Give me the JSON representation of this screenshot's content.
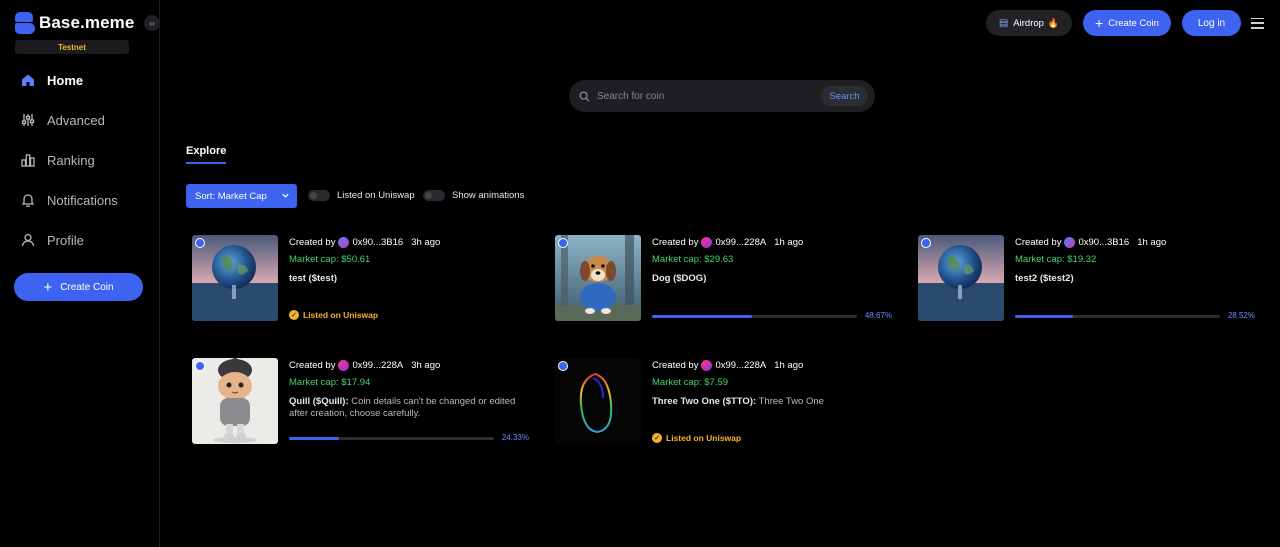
{
  "brand": {
    "name": "Base.meme",
    "network_badge": "Testnet"
  },
  "sidebar": {
    "items": [
      {
        "label": "Home",
        "icon": "home-icon",
        "active": true
      },
      {
        "label": "Advanced",
        "icon": "sliders-icon"
      },
      {
        "label": "Ranking",
        "icon": "bar-chart-icon"
      },
      {
        "label": "Notifications",
        "icon": "bell-icon"
      },
      {
        "label": "Profile",
        "icon": "user-icon"
      }
    ],
    "create_button": "Create Coin"
  },
  "header": {
    "airdrop_label": "Airdrop",
    "create_label": "Create Coin",
    "login_label": "Log in"
  },
  "search": {
    "placeholder": "Search for coin",
    "button_label": "Search"
  },
  "tabs": {
    "explore": "Explore"
  },
  "filters": {
    "sort_label": "Sort: Market Cap",
    "toggle_uniswap_label": "Listed on Uniswap",
    "toggle_animations_label": "Show animations"
  },
  "colors": {
    "accent": "#3d63f0",
    "market_cap": "#45d46a",
    "listed": "#f5b52a"
  },
  "coins": [
    {
      "created_by_label": "Created by",
      "creator": "0x90...3B16",
      "time": "3h ago",
      "market_cap": "Market cap: $50.61",
      "name": "test ($test)",
      "description": "",
      "status_text": "Listed on Uniswap",
      "image": "earth-in-water"
    },
    {
      "created_by_label": "Created by",
      "creator": "0x99...228A",
      "time": "1h ago",
      "market_cap": "Market cap: $29.63",
      "name": "Dog ($DOG)",
      "description": "",
      "progress": 48.67,
      "progress_text": "48.67%",
      "image": "dog-in-hoodie"
    },
    {
      "created_by_label": "Created by",
      "creator": "0x90...3B16",
      "time": "1h ago",
      "market_cap": "Market cap: $19.32",
      "name": "test2 ($test2)",
      "description": "",
      "progress": 28.52,
      "progress_text": "28.52%",
      "image": "earth-in-water"
    },
    {
      "created_by_label": "Created by",
      "creator": "0x99...228A",
      "time": "3h ago",
      "market_cap": "Market cap: $17.94",
      "name": "Quill ($Quill):",
      "description": "Coin details can't be changed or edited after creation, choose carefully.",
      "progress": 24.33,
      "progress_text": "24.33%",
      "image": "character-in-hat"
    },
    {
      "created_by_label": "Created by",
      "creator": "0x99...228A",
      "time": "1h ago",
      "market_cap": "Market cap: $7.59",
      "name": "Three Two One ($TTO):",
      "description": "Three Two One",
      "status_text": "Listed on Uniswap",
      "image": "rainbow-loop"
    }
  ]
}
